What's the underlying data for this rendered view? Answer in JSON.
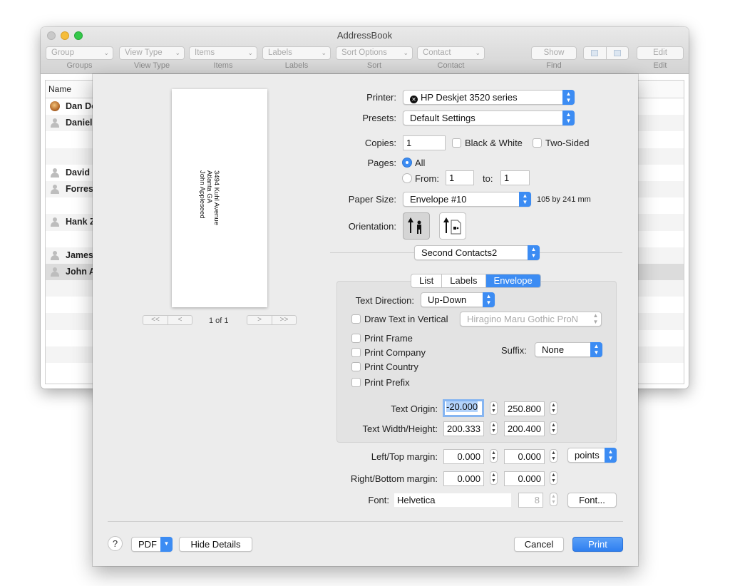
{
  "window": {
    "title": "AddressBook",
    "toolbar": {
      "popups": [
        {
          "value": "Group",
          "label": "Groups"
        },
        {
          "value": "View Type",
          "label": "View Type"
        },
        {
          "value": "Items",
          "label": "Items"
        },
        {
          "value": "Labels",
          "label": "Labels"
        },
        {
          "value": "Sort Options",
          "label": "Sort"
        },
        {
          "value": "Contact",
          "label": "Contact"
        }
      ],
      "show_button": "Show",
      "find_label": "Find",
      "edit_button": "Edit",
      "edit_label": "Edit"
    },
    "table": {
      "column": "Name",
      "rows": [
        "Dan Do",
        "Daniel",
        "",
        "",
        "David",
        "Forres",
        "",
        "Hank Z",
        "",
        "James",
        "John A",
        "",
        "",
        "",
        "",
        "",
        ""
      ]
    }
  },
  "print_dialog": {
    "preview": {
      "address_lines": [
        "3494 Kuhl Avenue",
        "Atlanta GA",
        "John Appleseed"
      ],
      "first_btn": "<<",
      "prev_btn": "<",
      "next_btn": ">",
      "last_btn": ">>",
      "page_count": "1 of 1"
    },
    "printer": {
      "label": "Printer:",
      "value": "HP Deskjet 3520 series"
    },
    "presets": {
      "label": "Presets:",
      "value": "Default Settings"
    },
    "copies": {
      "label": "Copies:",
      "value": "1",
      "bw": "Black & White",
      "two_sided": "Two-Sided"
    },
    "pages": {
      "label": "Pages:",
      "all": "All",
      "from": "From:",
      "from_value": "1",
      "to": "to:",
      "to_value": "1"
    },
    "paper_size": {
      "label": "Paper Size:",
      "value": "Envelope #10",
      "dims": "105 by 241 mm"
    },
    "orientation": {
      "label": "Orientation:"
    },
    "app_section": "Second Contacts2",
    "tabs": [
      "List",
      "Labels",
      "Envelope"
    ],
    "envelope": {
      "text_direction_label": "Text Direction:",
      "text_direction": "Up-Down",
      "vertical_label": "Draw Text in Vertical",
      "vertical_font": "Hiragino Maru Gothic ProN",
      "print_frame": "Print Frame",
      "print_company": "Print Company",
      "print_country": "Print Country",
      "print_prefix": "Print Prefix",
      "suffix_label": "Suffix:",
      "suffix_value": "None",
      "text_origin_label": "Text Origin:",
      "origin_x_hl": "-20.000",
      "origin_y": "250.800",
      "text_size_label": "Text Width/Height:",
      "width": "200.333",
      "height": "200.400"
    },
    "margins": {
      "lt_label": "Left/Top margin:",
      "left": "0.000",
      "top": "0.000",
      "unit": "points",
      "rb_label": "Right/Bottom margin:",
      "right": "0.000",
      "bottom": "0.000"
    },
    "font": {
      "label": "Font:",
      "name": "Helvetica",
      "size": "8",
      "button": "Font..."
    },
    "footer": {
      "help": "?",
      "pdf": "PDF",
      "hide_details": "Hide Details",
      "cancel": "Cancel",
      "print": "Print"
    }
  }
}
